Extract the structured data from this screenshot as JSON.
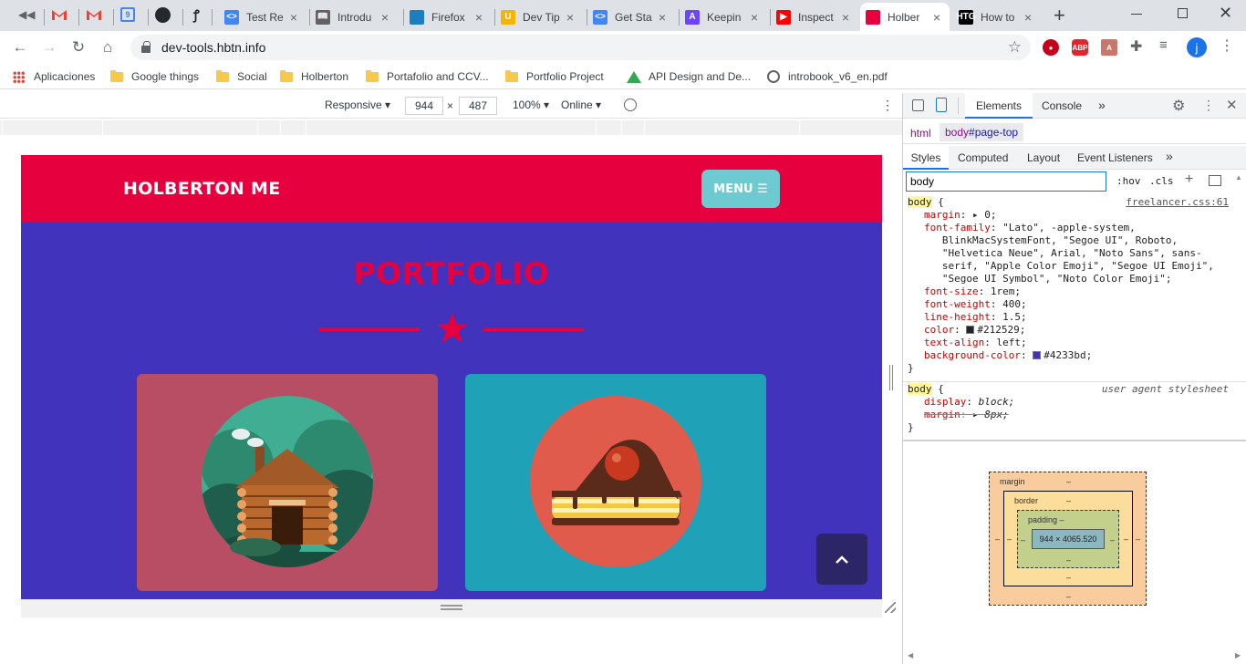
{
  "browser": {
    "tabs": [
      {
        "title": "Test Re",
        "fav": "<>",
        "fav_color": "#4285f4"
      },
      {
        "title": "Introdu",
        "fav": "📖",
        "fav_color": "#5f6368"
      },
      {
        "title": "Firefox",
        "fav": "",
        "fav_color": "#1a7fc1"
      },
      {
        "title": "Dev Tip",
        "fav": "U",
        "fav_color": "#f5b400"
      },
      {
        "title": "Get Sta",
        "fav": "<>",
        "fav_color": "#4285f4"
      },
      {
        "title": "Keepin",
        "fav": "A",
        "fav_color": "#6e44ff"
      },
      {
        "title": "Inspect",
        "fav": "▶",
        "fav_color": "#ff0000"
      },
      {
        "title": "Holber",
        "fav": "",
        "fav_color": "#e6003e",
        "active": true
      },
      {
        "title": "How to",
        "fav": "HTG",
        "fav_color": "#000000"
      }
    ],
    "new_tab_label": "+",
    "url": "dev-tools.hbtn.info",
    "profile_initial": "j",
    "bookmarks": [
      {
        "label": "Aplicaciones",
        "type": "apps"
      },
      {
        "label": "Google things",
        "type": "folder"
      },
      {
        "label": "Social",
        "type": "folder"
      },
      {
        "label": "Holberton",
        "type": "folder"
      },
      {
        "label": "Portafolio and CCV...",
        "type": "folder"
      },
      {
        "label": "Portfolio Project",
        "type": "folder"
      },
      {
        "label": "API Design and De...",
        "type": "drive"
      },
      {
        "label": "introbook_v6_en.pdf",
        "type": "globe"
      }
    ]
  },
  "device_toolbar": {
    "mode": "Responsive",
    "width": "944",
    "height": "487",
    "times": "×",
    "zoom": "100%",
    "network": "Online"
  },
  "site": {
    "brand": "HOLBERTON ME",
    "menu_label": "MENU ☰",
    "section_title": "PORTFOLIO",
    "cards": [
      {
        "name": "cabin",
        "bg": "#b84e64"
      },
      {
        "name": "cake",
        "bg": "#1fa2b7"
      }
    ],
    "colors": {
      "nav": "#e6003e",
      "page_bg": "#4233bd",
      "menu_btn": "#6dcad1"
    }
  },
  "devtools": {
    "main_tabs": [
      "Elements",
      "Console",
      "»"
    ],
    "breadcrumb": [
      {
        "tag": "html",
        "suffix": ""
      },
      {
        "tag": "body",
        "suffix": "#page-top"
      }
    ],
    "sub_tabs": [
      "Styles",
      "Computed",
      "Layout",
      "Event Listeners",
      "»"
    ],
    "filter_value": "body",
    "hov": ":hov",
    "cls": ".cls",
    "rule1": {
      "selector": "body",
      "source": "freelancer.css:61",
      "lines": [
        {
          "p": "margin",
          "v": "▸ 0;"
        },
        {
          "p": "font-family",
          "v": "\"Lato\", -apple-system,"
        },
        {
          "p": "",
          "v": "   BlinkMacSystemFont, \"Segoe UI\", Roboto,"
        },
        {
          "p": "",
          "v": "   \"Helvetica Neue\", Arial, \"Noto Sans\", sans-"
        },
        {
          "p": "",
          "v": "   serif, \"Apple Color Emoji\", \"Segoe UI Emoji\","
        },
        {
          "p": "",
          "v": "   \"Segoe UI Symbol\", \"Noto Color Emoji\";"
        },
        {
          "p": "font-size",
          "v": "1rem;"
        },
        {
          "p": "font-weight",
          "v": "400;"
        },
        {
          "p": "line-height",
          "v": "1.5;"
        },
        {
          "p": "color",
          "v": "#212529;",
          "swatch": "#212529"
        },
        {
          "p": "text-align",
          "v": "left;"
        },
        {
          "p": "background-color",
          "v": "#4233bd;",
          "swatch": "#4233bd"
        }
      ]
    },
    "rule2": {
      "selector": "body",
      "source": "user agent stylesheet",
      "lines": [
        {
          "p": "display",
          "v": "block;"
        },
        {
          "p": "margin",
          "v": "▸ 8px;"
        }
      ]
    },
    "box_model": {
      "margin_label": "margin",
      "border_label": "border",
      "padding_label": "padding –",
      "content": "944 × 4065.520",
      "dash": "–"
    }
  }
}
